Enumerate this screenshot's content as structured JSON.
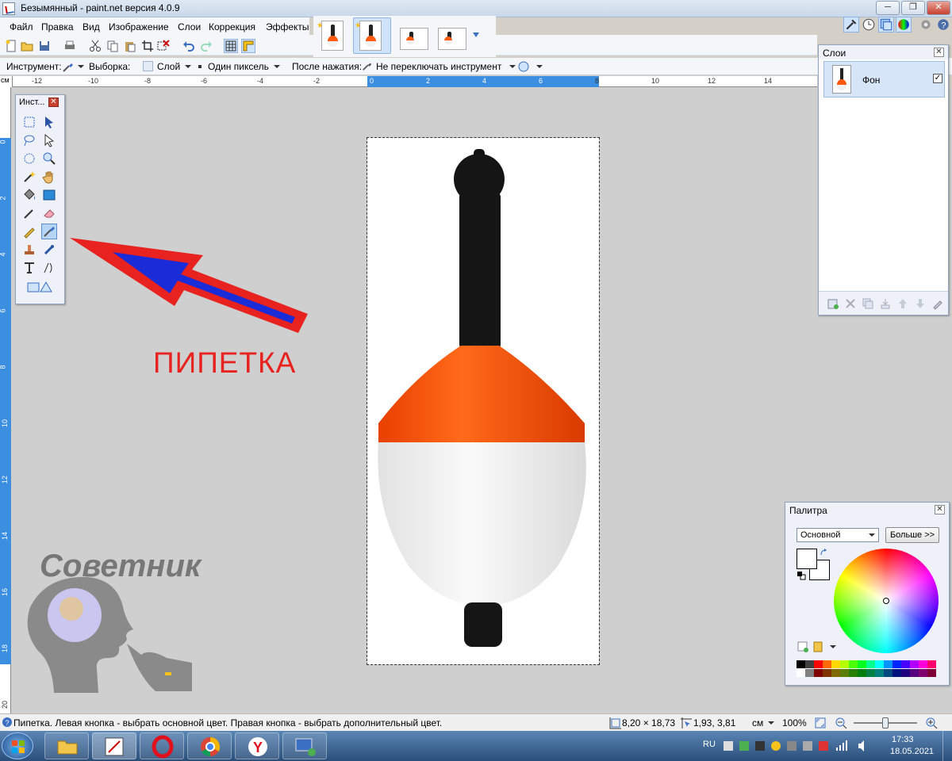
{
  "window": {
    "title": "Безымянный - paint.net версия 4.0.9",
    "minimize": "─",
    "maximize": "❐",
    "close": "✕"
  },
  "menu": [
    "Файл",
    "Правка",
    "Вид",
    "Изображение",
    "Слои",
    "Коррекция",
    "Эффекты"
  ],
  "options": {
    "tool_label": "Инструмент:",
    "selection_label": "Выборка:",
    "layer_value": "Слой",
    "pixel_value": "Один пиксель",
    "after_label": "После нажатия:",
    "after_value": "Не переключать инструмент"
  },
  "ruler": {
    "units": "см",
    "h_ticks": [
      "-12",
      "-10",
      "-8",
      "-6",
      "-4",
      "-2",
      "0",
      "2",
      "4",
      "6",
      "8",
      "10",
      "12",
      "14"
    ],
    "v_ticks": [
      "0",
      "2",
      "4",
      "6",
      "8",
      "10",
      "12",
      "14",
      "16",
      "18",
      "20"
    ]
  },
  "tools_window": {
    "title": "Инст..."
  },
  "layers_window": {
    "title": "Слои",
    "layer_name": "Фон"
  },
  "palette_window": {
    "title": "Палитра",
    "palette_select": "Основной",
    "more_button": "Больше >>",
    "colors": [
      "#000000",
      "#404040",
      "#ff0000",
      "#ff6a00",
      "#ffd800",
      "#b6ff00",
      "#4cff00",
      "#00ff21",
      "#00ff90",
      "#00ffff",
      "#0094ff",
      "#0026ff",
      "#4800ff",
      "#b200ff",
      "#ff00dc",
      "#ff006e",
      "#ffffff",
      "#808080",
      "#7f0000",
      "#7f3300",
      "#7f6a00",
      "#5b7f00",
      "#267f00",
      "#007f0e",
      "#007f46",
      "#007f7f",
      "#004a7f",
      "#00137f",
      "#21007f",
      "#57007f",
      "#7f006e",
      "#7f0037"
    ]
  },
  "annotation": {
    "label": "ПИПЕТКА",
    "watermark": "Советник",
    "label_color": "#e8221e",
    "arrow_color": "#1a2bd8"
  },
  "status": {
    "message": "Пипетка. Левая кнопка - выбрать основной цвет. Правая кнопка - выбрать дополнительный цвет.",
    "size": "8,20 × 18,73",
    "cursor": "1,93, 3,81",
    "units": "см",
    "zoom": "100%"
  },
  "taskbar": {
    "lang": "RU",
    "time": "17:33",
    "date": "18.05.2021"
  }
}
